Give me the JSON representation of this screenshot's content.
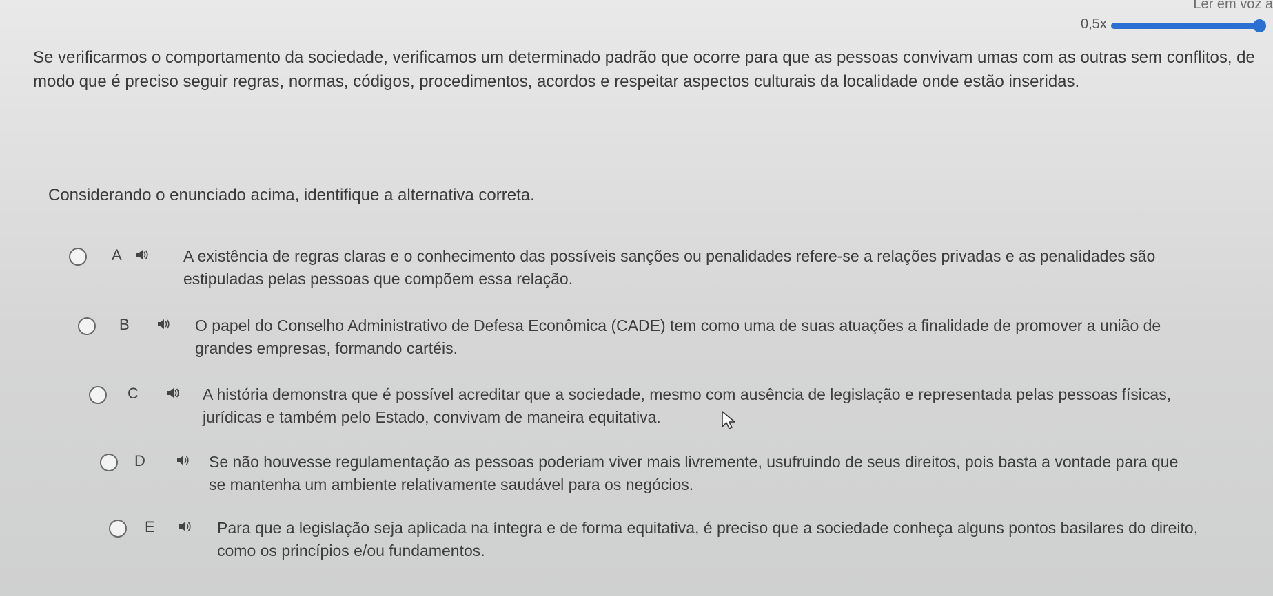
{
  "toolbar": {
    "read_aloud_label": "Ler em voz a",
    "speed_label": "0,5x",
    "speed_max": "2",
    "speed_fraction": 0.95
  },
  "question": {
    "paragraph": "Se verificarmos o comportamento da sociedade, verificamos um determinado padrão que ocorre para que as pessoas convivam umas com as outras sem conflitos, de modo que é preciso seguir regras, normas, códigos, procedimentos, acordos e respeitar aspectos culturais da localidade onde estão inseridas.",
    "prompt": "Considerando o enunciado acima, identifique a alternativa correta."
  },
  "options": [
    {
      "letter": "A",
      "text": "A existência de regras claras e o conhecimento das possíveis sanções ou penalidades refere-se a relações privadas e as penalidades são estipuladas pelas pessoas que compõem essa relação."
    },
    {
      "letter": "B",
      "text": "O papel do Conselho Administrativo de Defesa Econômica (CADE) tem como uma de suas atuações a finalidade de promover a união de grandes empresas, formando cartéis."
    },
    {
      "letter": "C",
      "text": "A história demonstra que é possível acreditar que a sociedade, mesmo com ausência de legislação e representada pelas pessoas físicas, jurídicas e também pelo Estado, convivam de maneira equitativa."
    },
    {
      "letter": "D",
      "text": "Se não houvesse regulamentação as pessoas poderiam viver mais livremente, usufruindo de seus direitos, pois basta a vontade para que se mantenha um ambiente relativamente saudável para os negócios."
    },
    {
      "letter": "E",
      "text": "Para que a legislação seja aplicada na íntegra e de forma equitativa, é preciso que a sociedade conheça alguns pontos basilares do direito, como os princípios e/ou fundamentos."
    }
  ],
  "icons": {
    "speaker": "speaker-icon",
    "cursor": "mouse-pointer-icon"
  }
}
